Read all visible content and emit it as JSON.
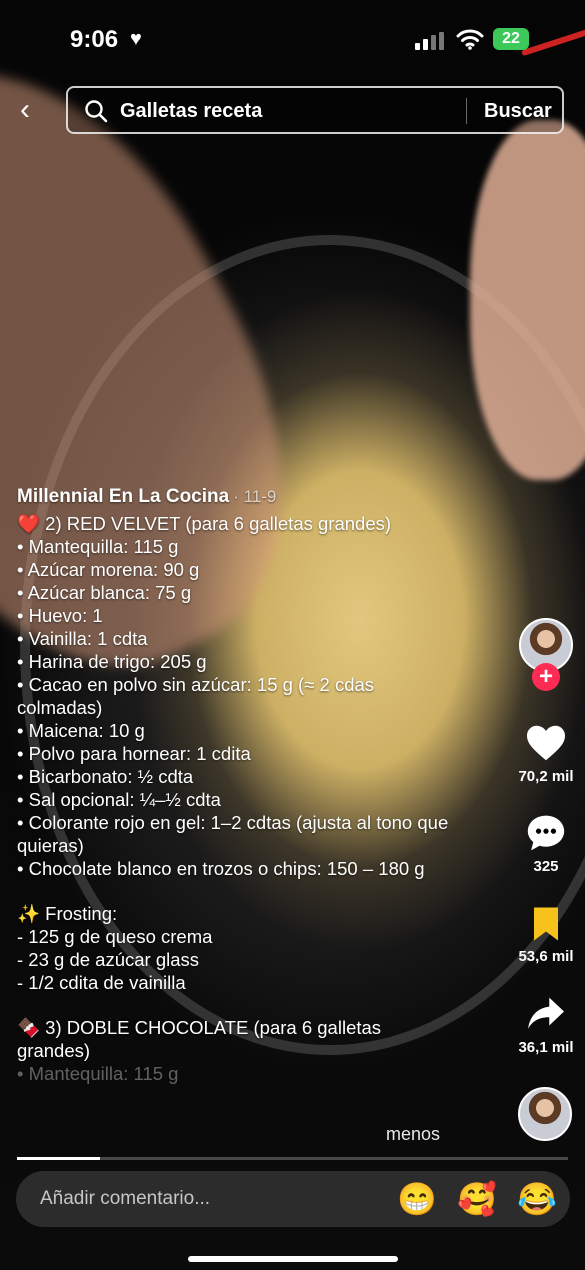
{
  "status_bar": {
    "time": "9:06",
    "battery": "22"
  },
  "search": {
    "query": "Galletas receta",
    "button": "Buscar"
  },
  "post": {
    "author": "Millennial En La Cocina",
    "date": "· 11-9",
    "caption_lines": [
      "❤️ 2) RED VELVET (para 6 galletas grandes)",
      "• Mantequilla: 115 g",
      "• Azúcar morena: 90 g",
      "• Azúcar blanca: 75 g",
      "• Huevo: 1",
      "• Vainilla: 1 cdta",
      "• Harina de trigo: 205 g",
      "• Cacao en polvo sin azúcar: 15 g (≈ 2 cdas colmadas)",
      "• Maicena: 10 g",
      "• Polvo para hornear: 1 cdita",
      "• Bicarbonato: ½ cdta",
      "• Sal opcional: ¼–½ cdta",
      "• Colorante rojo en gel: 1–2 cdtas (ajusta al tono que quieras)",
      "• Chocolate blanco en trozos o chips: 150 – 180 g",
      "",
      "✨ Frosting:",
      "- 125 g de queso crema",
      "- 23 g de azúcar glass",
      "- 1/2 cdita de vainilla",
      "",
      "🍫 3) DOBLE CHOCOLATE (para 6 galletas grandes)"
    ],
    "faded_line": "• Mantequilla: 115 g",
    "less_label": "menos"
  },
  "actions": {
    "likes": "70,2 mil",
    "comments": "325",
    "saves": "53,6 mil",
    "shares": "36,1 mil",
    "follow_symbol": "+"
  },
  "progress": 0.15,
  "comment_bar": {
    "placeholder": "Añadir comentario...",
    "emojis": [
      "😁",
      "🥰",
      "😂"
    ]
  },
  "colors": {
    "like_red": "#fe2c55",
    "save_yellow": "#f8c21c",
    "battery_green": "#3cc95a"
  }
}
